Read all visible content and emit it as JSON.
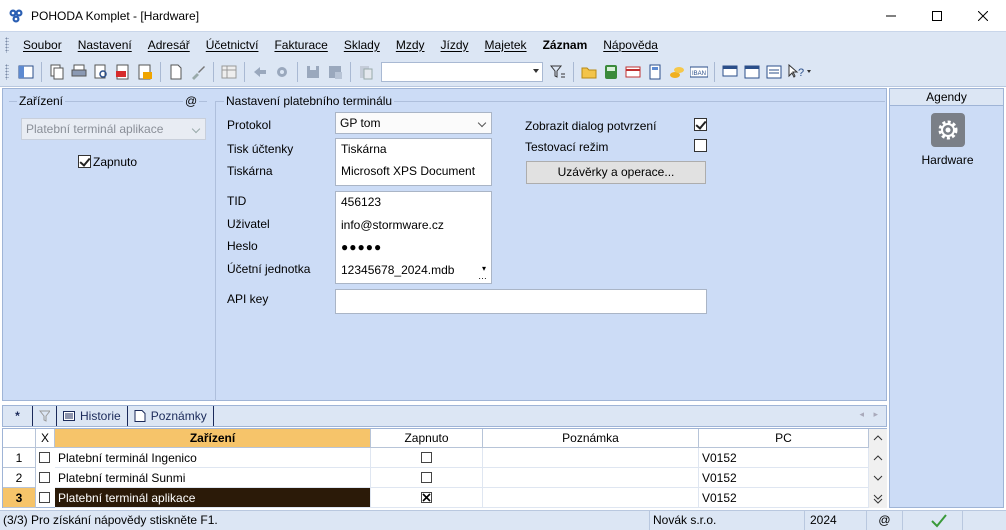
{
  "window": {
    "title": "POHODA Komplet - [Hardware]"
  },
  "menu": [
    "Soubor",
    "Nastavení",
    "Adresář",
    "Účetnictví",
    "Fakturace",
    "Sklady",
    "Mzdy",
    "Jízdy",
    "Majetek",
    "Záznam",
    "Nápověda"
  ],
  "device": {
    "legend": "Zařízení",
    "at": "@",
    "selected_device": "Platební terminál aplikace",
    "enabled_label": "Zapnuto",
    "enabled": true
  },
  "terminal": {
    "legend": "Nastavení platebního terminálu",
    "protocol_label": "Protokol",
    "protocol_value": "GP tom",
    "receipt_label": "Tisk účtenky",
    "receipt_value": "Tiskárna",
    "printer_label": "Tiskárna",
    "printer_value": "Microsoft XPS Document",
    "tid_label": "TID",
    "tid_value": "456123",
    "user_label": "Uživatel",
    "user_value": "info@stormware.cz",
    "password_label": "Heslo",
    "password_value": "●●●●●",
    "unit_label": "Účetní jednotka",
    "unit_value": "12345678_2024.mdb",
    "api_label": "API key",
    "api_value": "",
    "confirm_dialog_label": "Zobrazit dialog potvrzení",
    "confirm_dialog": true,
    "test_mode_label": "Testovací režim",
    "test_mode": false,
    "closing_button": "Uzávěrky a operace..."
  },
  "agenda": {
    "title": "Agendy",
    "item": "Hardware"
  },
  "tabs": {
    "star": "*",
    "history": "Historie",
    "notes": "Poznámky"
  },
  "grid": {
    "headers": {
      "x": "X",
      "device": "Zařízení",
      "enabled": "Zapnuto",
      "note": "Poznámka",
      "pc": "PC"
    },
    "rows": [
      {
        "num": "1",
        "name": "Platební terminál Ingenico",
        "enabled": false,
        "note": "",
        "pc": "V0152"
      },
      {
        "num": "2",
        "name": "Platební terminál Sunmi",
        "enabled": false,
        "note": "",
        "pc": "V0152"
      },
      {
        "num": "3",
        "name": "Platební terminál aplikace",
        "enabled": true,
        "note": "",
        "pc": "V0152"
      }
    ]
  },
  "status": {
    "help": "(3/3) Pro získání nápovědy stiskněte F1.",
    "company": "Novák s.r.o.",
    "year": "2024",
    "at": "@"
  }
}
